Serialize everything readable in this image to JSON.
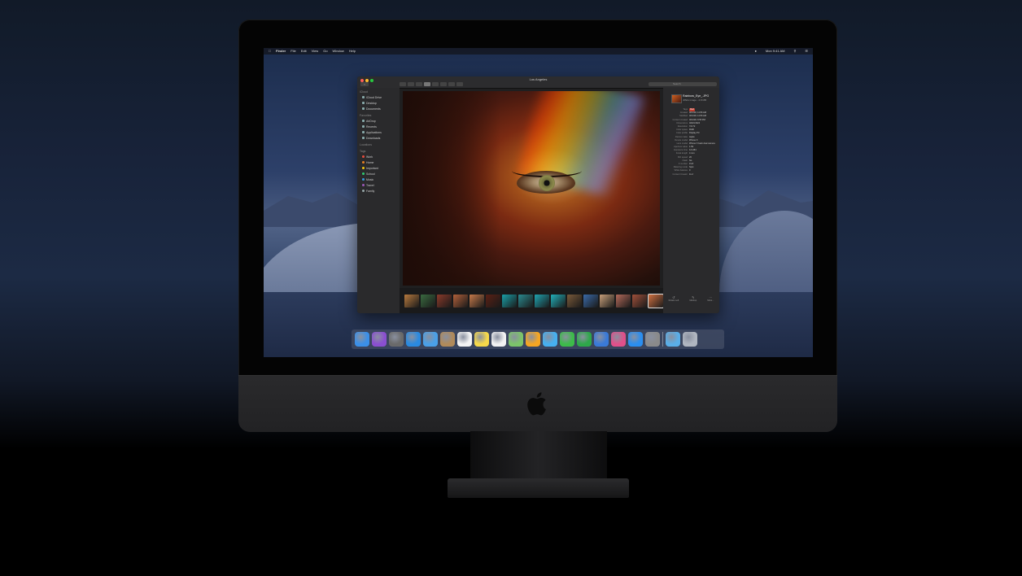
{
  "menubar": {
    "app": "Finder",
    "items": [
      "File",
      "Edit",
      "View",
      "Go",
      "Window",
      "Help"
    ],
    "clock": "Mon 9:41 AM"
  },
  "window": {
    "title": "Los Angeles",
    "search_placeholder": "Search"
  },
  "sidebar": {
    "sections": [
      {
        "header": "iCloud",
        "items": [
          "iCloud Drive",
          "Desktop",
          "Documents"
        ]
      },
      {
        "header": "Favorites",
        "items": [
          "AirDrop",
          "Recents",
          "Applications",
          "Downloads"
        ]
      },
      {
        "header": "Locations",
        "items": []
      },
      {
        "header": "Tags",
        "items": [
          "Work",
          "Home",
          "Important",
          "School",
          "Music",
          "Travel",
          "Family"
        ]
      }
    ],
    "tag_colors": [
      "#e74c3c",
      "#e67e22",
      "#f1c40f",
      "#2ecc71",
      "#3498db",
      "#9b59b6",
      "#95a5a6"
    ]
  },
  "inspector": {
    "file_name": "Rainbow_Eye_.JPG",
    "file_kind": "JPEG image - 2.8 MB",
    "rows": [
      {
        "k": "Tags",
        "v": "Red"
      },
      {
        "k": "Created",
        "v": "3/12/18, 11:56 AM"
      },
      {
        "k": "Modified",
        "v": "3/12/18, 11:56 AM"
      },
      {
        "k": "Content created",
        "v": "3/12/18, 6:55 PM"
      },
      {
        "k": "Dimensions",
        "v": "4032×3024"
      },
      {
        "k": "Resolution",
        "v": "72×72"
      },
      {
        "k": "Color space",
        "v": "RGB"
      },
      {
        "k": "Color profile",
        "v": "Display P3"
      },
      {
        "k": "Device make",
        "v": "Apple"
      },
      {
        "k": "Device model",
        "v": "iPhone X"
      },
      {
        "k": "Lens model",
        "v": "iPhone X back dual camera"
      },
      {
        "k": "Aperture value",
        "v": "1.69"
      },
      {
        "k": "Exposure time",
        "v": "1/4,464"
      },
      {
        "k": "Focal length",
        "v": "4 mm"
      },
      {
        "k": "ISO speed",
        "v": "20"
      },
      {
        "k": "Flash",
        "v": "No"
      },
      {
        "k": "F number",
        "v": "f/1.8"
      },
      {
        "k": "Metering mode",
        "v": "Spot"
      },
      {
        "k": "White balance",
        "v": "0"
      },
      {
        "k": "Content Creator",
        "v": "11.2"
      }
    ],
    "actions": [
      "Rotate Left",
      "Markup",
      "More..."
    ]
  },
  "colors": {
    "window_bg": "#1f1f20",
    "sidebar_bg": "#2a2a2c",
    "chin": "#2a2a2c"
  },
  "filmstrip": [
    "#b87a3e",
    "#3a6a40",
    "#8a3a2a",
    "#b2603a",
    "#c77a4a",
    "#5a2014",
    "#1aa0a8",
    "#2a8a90",
    "#1fa3b0",
    "#22b0ba",
    "#7a5a3a",
    "#3a6aa8",
    "#c8a07a",
    "#b46a5a",
    "#a0503a",
    "#d07040"
  ],
  "dock": [
    {
      "name": "finder-icon",
      "color": "#3b8fe8"
    },
    {
      "name": "siri-icon",
      "color": "#8a4fd0"
    },
    {
      "name": "launchpad-icon",
      "color": "#6a6a6a"
    },
    {
      "name": "safari-icon",
      "color": "#2a8ae0"
    },
    {
      "name": "mail-icon",
      "color": "#4aa0e8"
    },
    {
      "name": "contacts-icon",
      "color": "#b08a5a"
    },
    {
      "name": "calendar-icon",
      "color": "#f4f4f4"
    },
    {
      "name": "notes-icon",
      "color": "#f6d94a"
    },
    {
      "name": "reminders-icon",
      "color": "#f2f2f2"
    },
    {
      "name": "maps-icon",
      "color": "#7cc46a"
    },
    {
      "name": "photos-icon",
      "color": "#f5a623"
    },
    {
      "name": "messages-icon",
      "color": "#46b0f0"
    },
    {
      "name": "facetime-icon",
      "color": "#3dbb4a"
    },
    {
      "name": "numbers-icon",
      "color": "#2ea84a"
    },
    {
      "name": "keynote-icon",
      "color": "#3a7ad8"
    },
    {
      "name": "itunes-icon",
      "color": "#e0508a"
    },
    {
      "name": "app-store-icon",
      "color": "#2a8ef0"
    },
    {
      "name": "system-preferences-icon",
      "color": "#8a8a8a"
    },
    {
      "name": "downloads-folder-icon",
      "color": "#5aaee8"
    },
    {
      "name": "trash-icon",
      "color": "#b0b6c0"
    }
  ]
}
